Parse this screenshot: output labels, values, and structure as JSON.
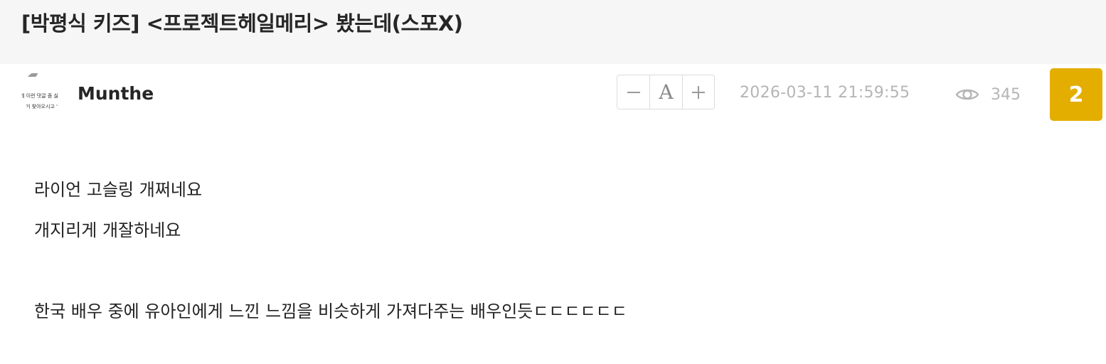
{
  "post": {
    "title": "[박평식 키즈] <프로젝트헤일메리> 봤는데(스포X)"
  },
  "author": {
    "avatar_line_1": "데 이런 댓글 좀 싫",
    "avatar_line_2": "거 찾아오시고 '",
    "username": "Munthe"
  },
  "font_control": {
    "decrease_icon": "minus-icon",
    "label": "A",
    "increase_icon": "plus-icon"
  },
  "meta": {
    "date": "2026-03-11 21:59:55",
    "views_icon": "eye-icon",
    "views": "345",
    "comment_count": "2"
  },
  "colors": {
    "title_background": "#f6f6f6",
    "badge": "#e3ae00",
    "meta_text": "#b5b5b5"
  },
  "body": {
    "lines": [
      "라이언 고슬링 개쩌네요",
      "개지리게 개잘하네요",
      "",
      "한국 배우 중에 유아인에게 느낀 느낌을 비슷하게 가져다주는 배우인듯ㄷㄷㄷㄷㄷㄷ"
    ]
  }
}
